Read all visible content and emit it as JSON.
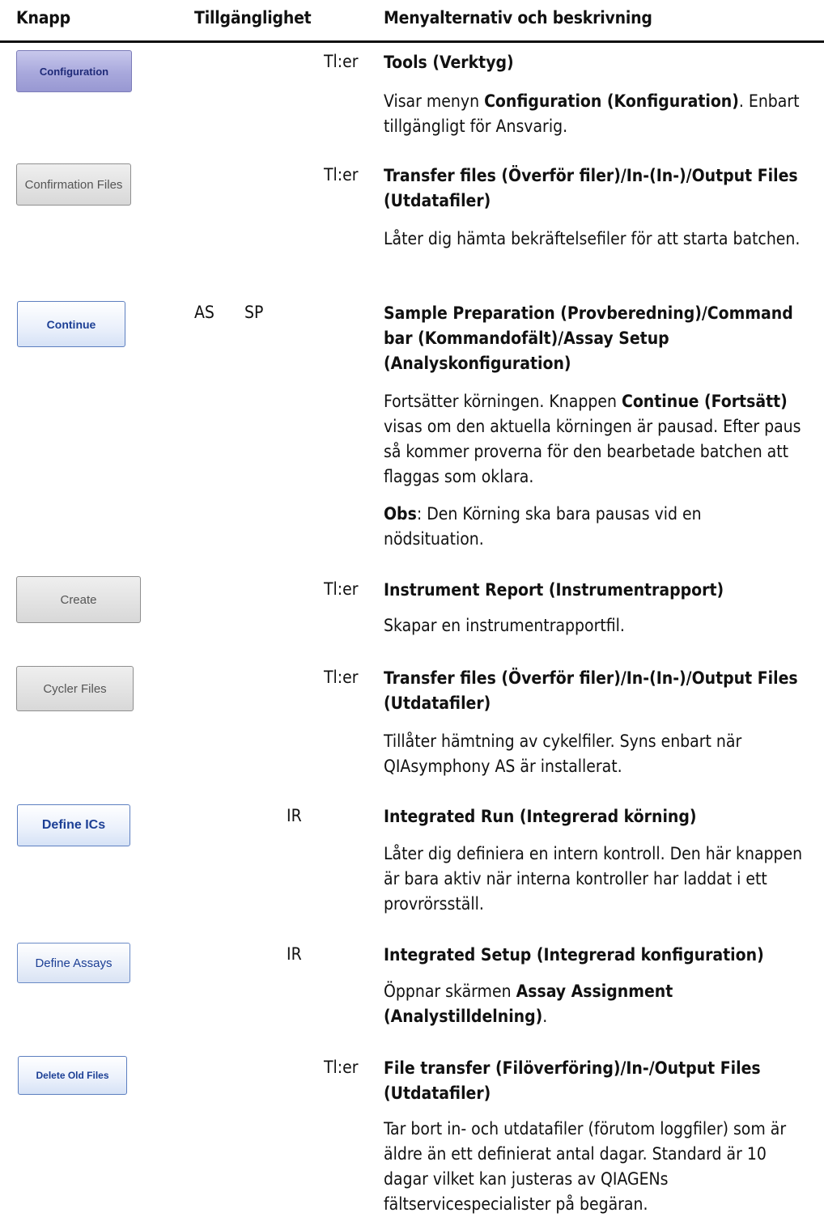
{
  "header": {
    "col_button": "Knapp",
    "col_availability": "Tillgänglighet",
    "col_menu": "Menyalternativ och beskrivning"
  },
  "rows": [
    {
      "button_label": "Configuration",
      "availability": [
        "Tl:er"
      ],
      "title": "Tools (Verktyg)",
      "desc": [
        [
          {
            "t": "Visar menyn "
          },
          {
            "t": "Configuration (Konfiguration)",
            "b": true
          },
          {
            "t": ". Enbart tillgängligt för Ansvarig."
          }
        ]
      ]
    },
    {
      "button_label": "Confirmation Files",
      "availability": [
        "Tl:er"
      ],
      "title": "Transfer files (Överför filer)/In-(In-)/Output Files (Utdatafiler)",
      "desc": [
        [
          {
            "t": "Låter dig hämta bekräftelsefiler för att starta batchen."
          }
        ]
      ]
    },
    {
      "button_label": "Continue",
      "availability": [
        "AS",
        "SP"
      ],
      "title": "Sample Preparation (Provberedning)/Command bar (Kommandofält)/Assay Setup (Analyskonfiguration)",
      "desc": [
        [
          {
            "t": "Fortsätter körningen. Knappen "
          },
          {
            "t": "Continue (Fortsätt)",
            "b": true
          },
          {
            "t": " visas om den aktuella körningen är pausad. Efter paus så kommer proverna för den bearbetade batchen att flaggas som oklara."
          }
        ],
        [
          {
            "t": "Obs",
            "b": true
          },
          {
            "t": ": Den Körning ska bara pausas vid en nödsituation."
          }
        ]
      ]
    },
    {
      "button_label": "Create",
      "availability": [
        "Tl:er"
      ],
      "title": "Instrument Report (Instrumentrapport)",
      "desc": [
        [
          {
            "t": "Skapar en instrumentrapportfil."
          }
        ]
      ]
    },
    {
      "button_label": "Cycler Files",
      "availability": [
        "Tl:er"
      ],
      "title": "Transfer files (Överför filer)/In-(In-)/Output Files (Utdatafiler)",
      "desc": [
        [
          {
            "t": "Tillåter hämtning av cykelfiler. Syns enbart när QIAsymphony AS är installerat."
          }
        ]
      ]
    },
    {
      "button_label": "Define ICs",
      "availability": [
        "IR"
      ],
      "title": "Integrated Run (Integrerad körning)",
      "desc": [
        [
          {
            "t": "Låter dig definiera en intern kontroll. Den här knappen är bara aktiv när interna kontroller har laddat i ett provrörsställ."
          }
        ]
      ]
    },
    {
      "button_label": "Define Assays",
      "availability": [
        "IR"
      ],
      "title": "Integrated Setup (Integrerad konfiguration)",
      "desc": [
        [
          {
            "t": "Öppnar skärmen "
          },
          {
            "t": "Assay Assignment (Analystilldelning)",
            "b": true
          },
          {
            "t": "."
          }
        ]
      ]
    },
    {
      "button_label": "Delete Old Files",
      "availability": [
        "Tl:er"
      ],
      "title": "File transfer (Filöverföring)/In-/Output Files (Utdatafiler)",
      "desc": [
        [
          {
            "t": "Tar bort in- och utdatafiler (förutom loggfiler) som är äldre än ett definierat antal dagar. Standard är 10 dagar vilket kan justeras av QIAGENs fältservicespecialister på begäran."
          }
        ]
      ]
    }
  ]
}
